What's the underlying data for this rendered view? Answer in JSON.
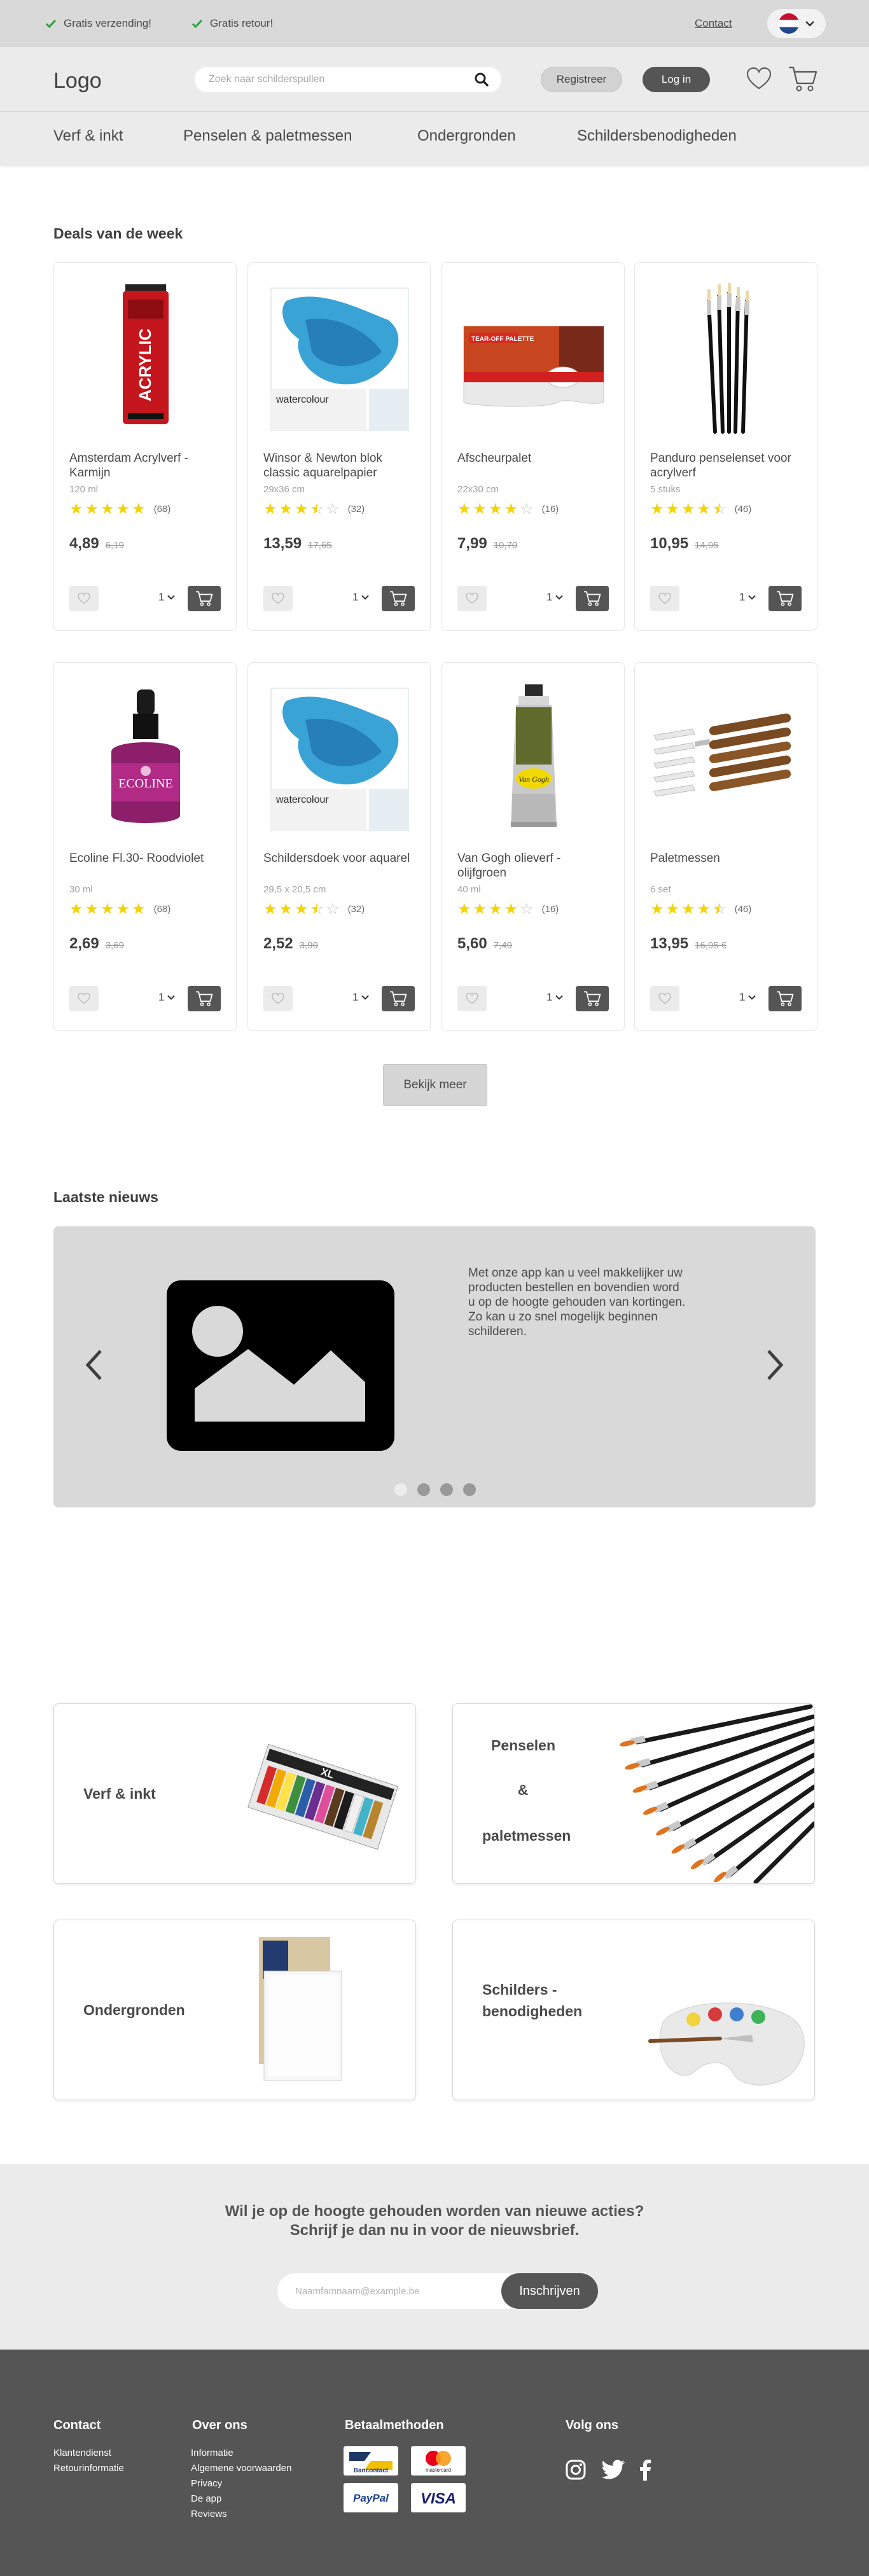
{
  "topbar": {
    "usp": [
      "Gratis verzending!",
      "Gratis retour!"
    ],
    "contact": "Contact"
  },
  "header": {
    "logo": "Logo",
    "search_placeholder": "Zoek naar schilderspullen",
    "register": "Registreer",
    "login": "Log in"
  },
  "nav": [
    "Verf & inkt",
    "Penselen & paletmessen",
    "Ondergronden",
    "Schildersbenodigheden"
  ],
  "deals": {
    "title": "Deals van de week",
    "products": [
      {
        "name": "Amsterdam Acrylverf - Karmijn",
        "size": "120 ml",
        "rating": 5,
        "reviews": "(68)",
        "price": "4,89",
        "old_price": "6,19",
        "qty": "1"
      },
      {
        "name": "Winsor & Newton blok classic aquarelpapier",
        "size": "29x36 cm",
        "rating": 3.5,
        "reviews": "(32)",
        "price": "13,59",
        "old_price": "17,65",
        "qty": "1"
      },
      {
        "name": "Afscheurpalet",
        "size": "22x30 cm",
        "rating": 4,
        "reviews": "(16)",
        "price": "7,99",
        "old_price": "10,70",
        "qty": "1"
      },
      {
        "name": "Panduro penselenset voor acrylverf",
        "size": "5 stuks",
        "rating": 4.5,
        "reviews": "(46)",
        "price": "10,95",
        "old_price": "14,95",
        "qty": "1"
      },
      {
        "name": "Ecoline Fl.30- Roodviolet",
        "size": "30 ml",
        "rating": 5,
        "reviews": "(68)",
        "price": "2,69",
        "old_price": "3,69",
        "qty": "1"
      },
      {
        "name": "Schildersdoek voor aquarel",
        "size": "29,5 x 20,5 cm",
        "rating": 3.5,
        "reviews": "(32)",
        "price": "2,52",
        "old_price": "3,99",
        "qty": "1"
      },
      {
        "name": "Van Gogh olieverf - olijfgroen",
        "size": "40 ml",
        "rating": 4,
        "reviews": "(16)",
        "price": "5,60",
        "old_price": "7,49",
        "qty": "1"
      },
      {
        "name": "Paletmessen",
        "size": "6 set",
        "rating": 4.5,
        "reviews": "(46)",
        "price": "13,95",
        "old_price": "16,95 €",
        "qty": "1"
      }
    ],
    "more": "Bekijk meer"
  },
  "news": {
    "title": "Laatste nieuws",
    "text": "Met onze app kan u veel makkelijker uw producten bestellen en bovendien word u op de hoogte gehouden van kortingen. Zo kan u zo snel mogelijk beginnen schilderen."
  },
  "categories": {
    "paint": "Verf & inkt",
    "brushes_1": "Penselen",
    "brushes_2": "&",
    "brushes_3": "paletmessen",
    "grounds": "Ondergronden",
    "supplies_1": "Schilders -",
    "supplies_2": "benodigheden"
  },
  "newsletter": {
    "line1": "Wil je op de hoogte gehouden worden van nieuwe acties?",
    "line2": "Schrijf je dan nu in voor de nieuwsbrief.",
    "placeholder": "Naamfamnaam@example.be",
    "button": "Inschrijven"
  },
  "footer": {
    "contact_title": "Contact",
    "contact_links": [
      "Klantendienst",
      "Retourinformatie"
    ],
    "about_title": "Over ons",
    "about_links": [
      "Informatie",
      "Algemene voorwaarden",
      "Privacy",
      "De app",
      "Reviews"
    ],
    "pay_title": "Betaalmethoden",
    "pay": [
      "Bancontact",
      "mastercard",
      "PayPal",
      "VISA"
    ],
    "follow_title": "Volg ons"
  },
  "colors": {
    "topbar": "#d9d9d9",
    "header": "#ebebeb",
    "dark": "#555555",
    "star": "#f3d400",
    "check": "#2e9e3e",
    "footer": "#555555"
  }
}
